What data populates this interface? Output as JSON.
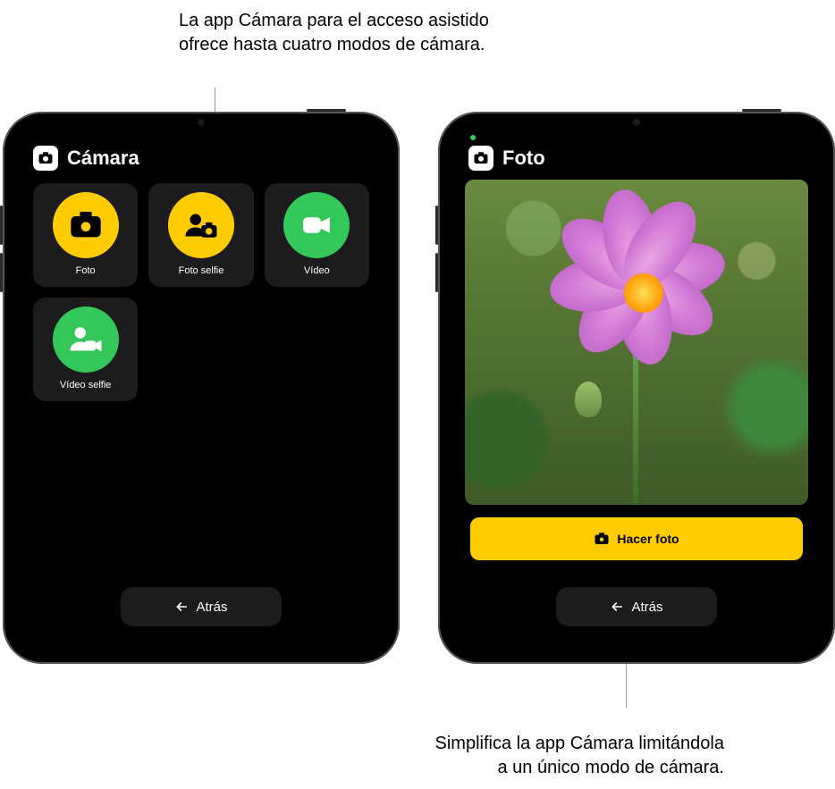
{
  "callouts": {
    "top": "La app Cámara para el acceso asistido ofrece hasta cuatro modos de cámara.",
    "bottom": "Simplifica la app Cámara limitándola a un único modo de cámara."
  },
  "left": {
    "title": "Cámara",
    "tiles": [
      {
        "label": "Foto",
        "color": "yellow",
        "icon": "camera"
      },
      {
        "label": "Foto selfie",
        "color": "yellow",
        "icon": "selfie-photo"
      },
      {
        "label": "Vídeo",
        "color": "green",
        "icon": "video"
      },
      {
        "label": "Vídeo selfie",
        "color": "green",
        "icon": "selfie-video"
      }
    ],
    "back_label": "Atrás"
  },
  "right": {
    "title": "Foto",
    "capture_label": "Hacer foto",
    "back_label": "Atrás"
  },
  "colors": {
    "yellow": "#ffcc00",
    "green": "#34c759",
    "tile_bg": "#1c1c1e"
  }
}
